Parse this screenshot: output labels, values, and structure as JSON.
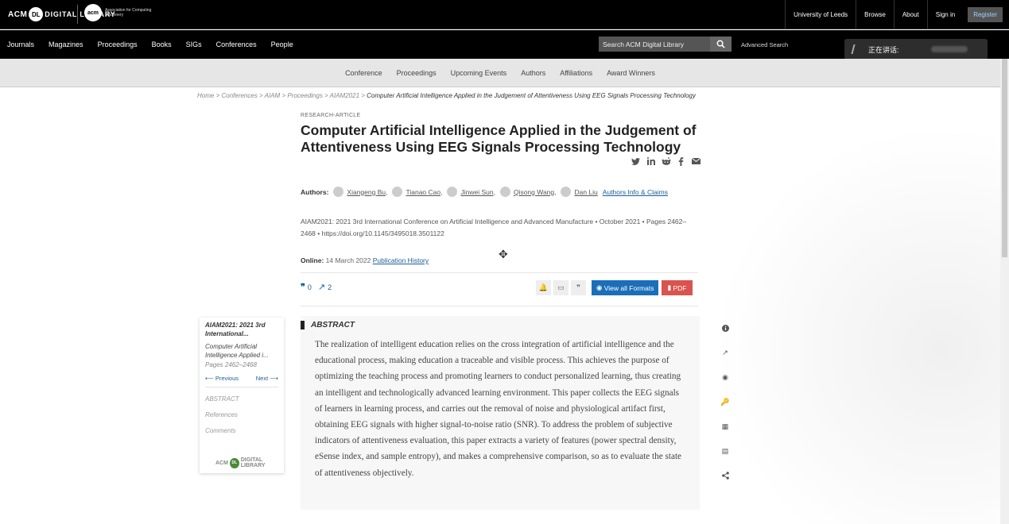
{
  "top": {
    "brand_acm": "ACM",
    "brand_dl_badge": "DL",
    "brand_dl_text": "DIGITAL LIBRARY",
    "acm_circle": "acm",
    "acm_assoc": "Association for Computing Machinery",
    "links": [
      "University of Leeds",
      "Browse",
      "About",
      "Sign in"
    ],
    "register": "Register"
  },
  "nav": {
    "items": [
      "Journals",
      "Magazines",
      "Proceedings",
      "Books",
      "SIGs",
      "Conferences",
      "People"
    ],
    "search_placeholder": "Search ACM Digital Library",
    "advanced": "Advanced Search"
  },
  "overlay": {
    "speaking": "正在讲话:"
  },
  "subnav": [
    "Conference",
    "Proceedings",
    "Upcoming Events",
    "Authors",
    "Affiliations",
    "Award Winners"
  ],
  "breadcrumb": {
    "items": [
      "Home",
      "Conferences",
      "AIAM",
      "Proceedings",
      "AIAM2021"
    ],
    "current": "Computer Artificial Intelligence Applied in the Judgement of Attentiveness Using EEG Signals Processing Technology"
  },
  "article": {
    "kind": "RESEARCH-ARTICLE",
    "title": "Computer Artificial Intelligence Applied in the Judgement of Attentiveness Using EEG Signals Processing Technology",
    "authors_label": "Authors:",
    "authors": [
      "Xiangeng Bu,",
      "Tianao Cao,",
      "Jinwei Sun,",
      "Qisong Wang,",
      "Dan Liu"
    ],
    "claims": "Authors Info & Claims",
    "pubinfo": "AIAM2021: 2021 3rd International Conference on Artificial Intelligence and Advanced Manufacture • October 2021 • Pages 2462–2468 • https://doi.org/10.1145/3495018.3501122",
    "online_label": "Online:",
    "online_date": "14 March 2022",
    "pub_history": "Publication History",
    "citations": "0",
    "downloads": "2",
    "view_formats": "View all Formats",
    "pdf": "PDF"
  },
  "sidebar": {
    "conf": "AIAM2021: 2021 3rd International...",
    "article": "Computer Artificial Intelligence Applied i...",
    "pages": "Pages 2462–2468",
    "previous": "Previous",
    "next": "Next",
    "links": [
      "ABSTRACT",
      "References",
      "Comments"
    ],
    "logo_acm": "ACM",
    "logo_badge": "DL",
    "logo_text": "DIGITAL LIBRARY"
  },
  "abstract": {
    "heading": "ABSTRACT",
    "text": "The realization of intelligent education relies on the cross integration of artificial intelligence and the educational process, making education a traceable and visible process. This achieves the purpose of optimizing the teaching process and promoting learners to conduct personalized learning, thus creating an intelligent and technologically advanced learning environment. This paper collects the EEG signals of learners in learning process, and carries out the removal of noise and physiological artifact first, obtaining EEG signals with higher signal-to-noise ratio (SNR). To address the problem of subjective indicators of attentiveness evaluation, this paper extracts a variety of features (power spectral density, eSense index, and sample entropy), and makes a comprehensive comparison, so as to evaluate the state of attentiveness objectively."
  },
  "colors": {
    "link": "#1a5e9a",
    "primary_button": "#1b6eb8",
    "pdf_button": "#d9534f"
  }
}
